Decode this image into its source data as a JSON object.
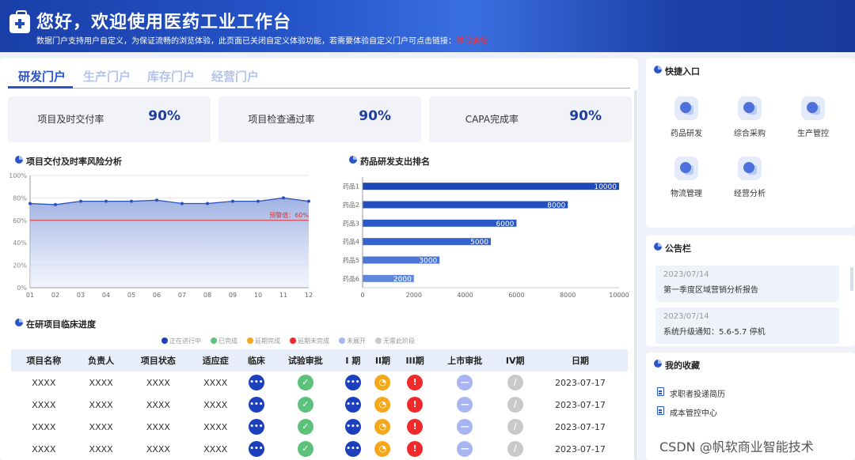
{
  "banner": {
    "title": "您好，欢迎使用医药工业工作台",
    "subtitle": "数据门户支持用户自定义，为保证流畅的浏览体验，此页面已关闭自定义体验功能，若需要体验自定义门户可点击链接：",
    "link_text": "体验链接"
  },
  "tabs": [
    "研发门户",
    "生产门户",
    "库存门户",
    "经营门户"
  ],
  "kpis": [
    {
      "label": "项目及时交付率",
      "value": "90%"
    },
    {
      "label": "项目检查通过率",
      "value": "90%"
    },
    {
      "label": "CAPA完成率",
      "value": "90%"
    }
  ],
  "line_section_title": "项目交付及时率风险分析",
  "bar_section_title": "药品研发支出排名",
  "table_section_title": "在研项目临床进度",
  "chart_data": [
    {
      "type": "area",
      "title": "项目交付及时率风险分析",
      "x": [
        "01",
        "02",
        "03",
        "04",
        "05",
        "06",
        "07",
        "08",
        "09",
        "10",
        "11",
        "12"
      ],
      "series": [
        {
          "values": [
            75,
            74,
            77,
            77,
            77,
            78,
            75,
            75,
            77,
            77,
            80,
            77
          ]
        }
      ],
      "y_ticks": [
        "0%",
        "20%",
        "40%",
        "60%",
        "80%",
        "100%"
      ],
      "ylim": [
        0,
        100
      ],
      "threshold": {
        "value": 60,
        "label": "预警值：60%",
        "color": "#e03030"
      },
      "line_color": "#2a4fbf",
      "grid": true
    },
    {
      "type": "bar",
      "orientation": "horizontal",
      "title": "药品研发支出排名",
      "categories": [
        "药品1",
        "药品2",
        "药品3",
        "药品4",
        "药品5",
        "药品6"
      ],
      "values": [
        10000,
        8000,
        6000,
        5000,
        3000,
        2000
      ],
      "x_ticks": [
        "0",
        "2000",
        "4000",
        "6000",
        "8000",
        "10000"
      ],
      "xlim": [
        0,
        10000
      ],
      "bar_colors": [
        "#1f47b8",
        "#2450c0",
        "#2a59c8",
        "#3462cf",
        "#4a75d6",
        "#5f88dd"
      ]
    }
  ],
  "legend": [
    {
      "label": "正在进行中",
      "color": "#1c3fbc"
    },
    {
      "label": "已完成",
      "color": "#5cc27b"
    },
    {
      "label": "延期完成",
      "color": "#f4a81a"
    },
    {
      "label": "延期未完成",
      "color": "#f02a2a"
    },
    {
      "label": "未展开",
      "color": "#a9b5f2"
    },
    {
      "label": "无需此阶段",
      "color": "#c9c9c9"
    }
  ],
  "table": {
    "headers": [
      "项目名称",
      "负责人",
      "项目状态",
      "适应症",
      "临床",
      "试验审批",
      "I 期",
      "II期",
      "III期",
      "上市审批",
      "IV期",
      "日期"
    ],
    "rows": [
      {
        "name": "XXXX",
        "owner": "XXXX",
        "status": "XXXX",
        "indication": "XXXX",
        "date": "2023-07-17"
      },
      {
        "name": "XXXX",
        "owner": "XXXX",
        "status": "XXXX",
        "indication": "XXXX",
        "date": "2023-07-17"
      },
      {
        "name": "XXXX",
        "owner": "XXXX",
        "status": "XXXX",
        "indication": "XXXX",
        "date": "2023-07-17"
      },
      {
        "name": "XXXX",
        "owner": "XXXX",
        "status": "XXXX",
        "indication": "XXXX",
        "date": "2023-07-17"
      }
    ],
    "stage_icons": [
      "running-icon",
      "done-icon",
      "running-icon",
      "delay-icon",
      "overdue-icon",
      "notstart-icon",
      "na-icon"
    ]
  },
  "quick_entry": {
    "title": "快捷入口",
    "items": [
      {
        "label": "药品研发",
        "icon": "pill-icon"
      },
      {
        "label": "综合采购",
        "icon": "purchase-icon"
      },
      {
        "label": "生产管控",
        "icon": "tools-icon"
      },
      {
        "label": "物流管理",
        "icon": "truck-icon"
      },
      {
        "label": "经营分析",
        "icon": "analysis-icon"
      }
    ]
  },
  "notices": {
    "title": "公告栏",
    "items": [
      {
        "date": "2023/07/14",
        "text": "第一季度区域营销分析报告"
      },
      {
        "date": "2023/07/14",
        "text": "系统升级通知：5.6-5.7 停机"
      }
    ]
  },
  "favorites": {
    "title": "我的收藏",
    "items": [
      "求职者投递简历",
      "成本管控中心"
    ]
  },
  "watermark": "CSDN @帆软商业智能技术"
}
